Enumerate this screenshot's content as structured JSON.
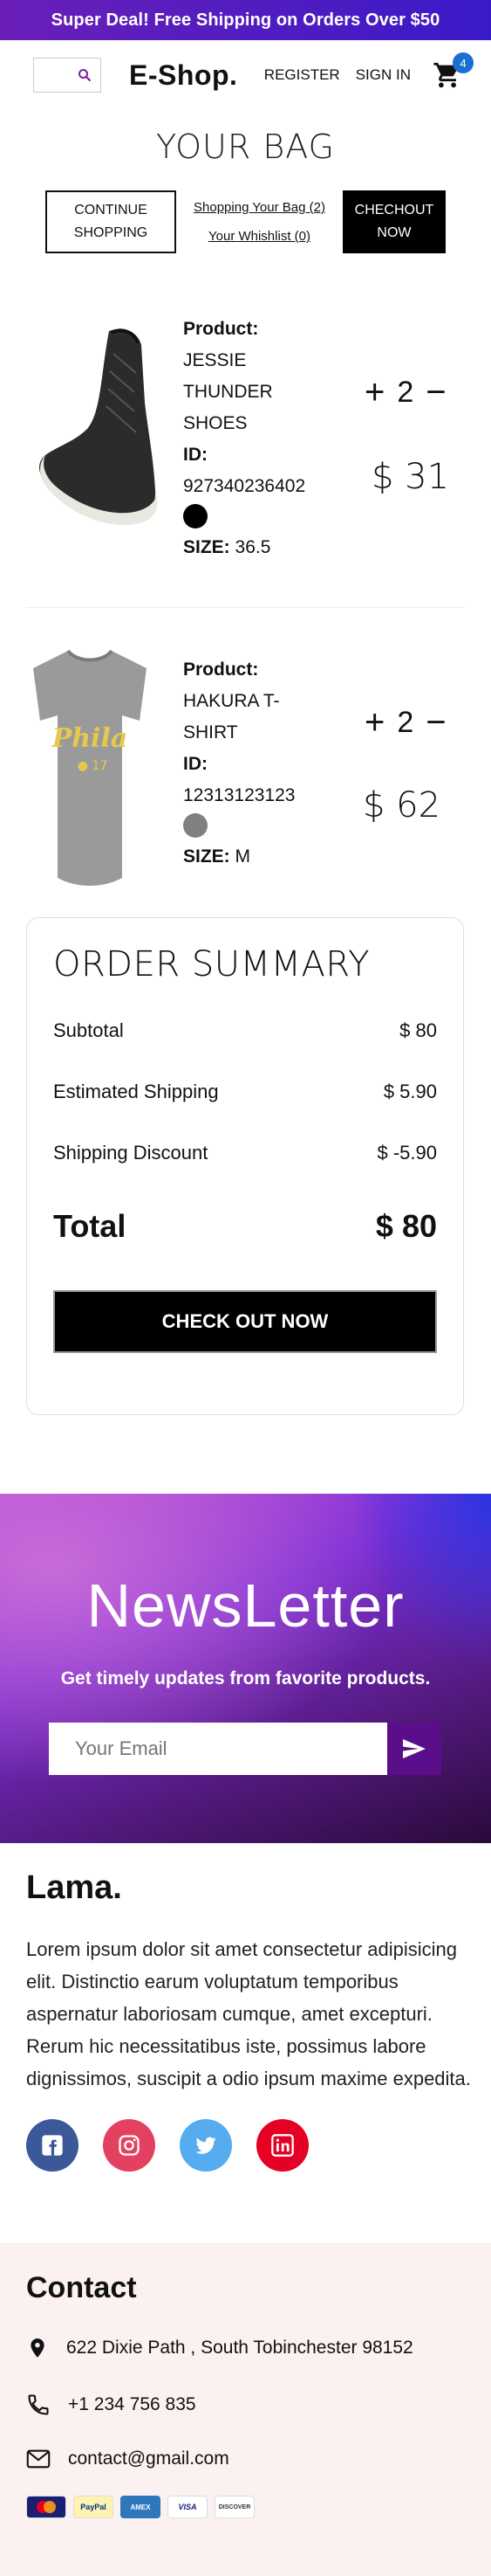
{
  "announcement": "Super Deal! Free Shipping on Orders Over $50",
  "navbar": {
    "brand": "E-Shop.",
    "register": "REGISTER",
    "signin": "SIGN IN",
    "cart_count": "4",
    "icons": [
      "search-icon",
      "cart-icon"
    ]
  },
  "bag": {
    "title": "YOUR BAG",
    "continue_label": "CONTINUE SHOPPING",
    "bag_link": "Shopping Your Bag (2)",
    "wishlist_link": "Your Whishlist (0)",
    "checkout_label": "CHECHOUT NOW"
  },
  "products": [
    {
      "product_label": "Product:",
      "name": "JESSIE THUNDER SHOES",
      "id_label": "ID:",
      "id": "927340236402",
      "color": "#000000",
      "size_label": "SIZE:",
      "size": "36.5",
      "qty": "2",
      "price": "$ 31"
    },
    {
      "product_label": "Product:",
      "name": "HAKURA T-SHIRT",
      "id_label": "ID:",
      "id": "12313123123",
      "color": "#808080",
      "size_label": "SIZE:",
      "size": "M",
      "qty": "2",
      "price": "$ 62"
    }
  ],
  "qty_symbols": {
    "plus": "+",
    "minus": "−"
  },
  "summary": {
    "title": "ORDER SUMMARY",
    "subtotal_label": "Subtotal",
    "subtotal": "$ 80",
    "shipping_label": "Estimated Shipping",
    "shipping": "$ 5.90",
    "discount_label": "Shipping Discount",
    "discount": "$ -5.90",
    "total_label": "Total",
    "total": "$ 80",
    "checkout_label": "CHECK OUT NOW"
  },
  "newsletter": {
    "title": "NewsLetter",
    "subtitle": "Get timely updates from favorite products.",
    "placeholder": "Your Email"
  },
  "footer": {
    "brand": "Lama.",
    "description": "Lorem ipsum dolor sit amet consectetur adipisicing elit. Distinctio earum voluptatum temporibus aspernatur laboriosam cumque, amet excepturi. Rerum hic necessitatibus iste, possimus labore dignissimos, suscipit a odio ipsum maxime expedita.",
    "socials": [
      {
        "name": "facebook-icon",
        "color": "#3b5999",
        "glyph": "f"
      },
      {
        "name": "instagram-icon",
        "color": "#e4405f",
        "glyph": "◎"
      },
      {
        "name": "twitter-icon",
        "color": "#55acee",
        "glyph": "t"
      },
      {
        "name": "linkedin-icon",
        "color": "#e60023",
        "glyph": "in"
      }
    ]
  },
  "contact": {
    "title": "Contact",
    "address": "622 Dixie Path , South Tobinchester 98152",
    "phone": "+1 234 756 835",
    "email": "contact@gmail.com",
    "payments": [
      "MasterCard",
      "PayPal",
      "AMEX",
      "VISA",
      "DISCOVER"
    ]
  }
}
